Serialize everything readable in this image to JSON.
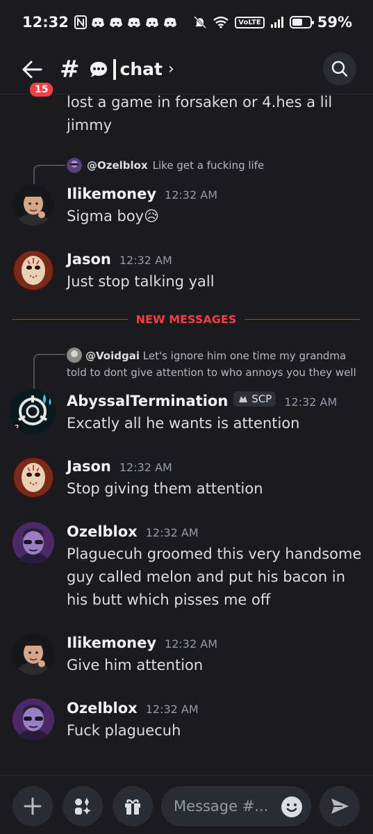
{
  "status": {
    "time": "12:32",
    "volte": "VoLTE",
    "battery": "59%",
    "battery_level": 0.59
  },
  "header": {
    "badge": "15",
    "channel": "chat",
    "channel_emoji": "speech-balloon"
  },
  "messages": {
    "prev_text": "lost a game in forsaken or 4.hes a lil jimmy",
    "m1": {
      "reply_name": "@Ozelblox",
      "reply_text": "Like get a fucking life",
      "user": "Ilikemoney",
      "time": "12:32 AM",
      "text": "Sigma boy",
      "emoji": "😥"
    },
    "m2": {
      "user": "Jason",
      "time": "12:32 AM",
      "text": "Just stop talking yall"
    },
    "divider": "NEW MESSAGES",
    "m3": {
      "reply_name": "@Voidgai",
      "reply_text": "Let's ignore him one time my grandma told to dont give attention to who annoys you they well",
      "user": "AbyssalTermination",
      "tag": "SCP",
      "time": "12:32 AM",
      "text": "Excatly all he wants is attention"
    },
    "m4": {
      "user": "Jason",
      "time": "12:32 AM",
      "text": "Stop giving them attention"
    },
    "m5": {
      "user": "Ozelblox",
      "time": "12:32 AM",
      "text": "Plaguecuh groomed this very handsome guy called melon and put his bacon in his butt which pisses me off"
    },
    "m6": {
      "user": "Ilikemoney",
      "time": "12:32 AM",
      "text": "Give him attention"
    },
    "m7": {
      "user": "Ozelblox",
      "time": "12:32 AM",
      "text": "Fuck plaguecuh"
    }
  },
  "composer": {
    "placeholder": "Message #..."
  },
  "colors": {
    "background": "#1b1b1f",
    "accent_red": "#f23f43",
    "text": "#dbdee1",
    "muted": "#949ba4"
  }
}
